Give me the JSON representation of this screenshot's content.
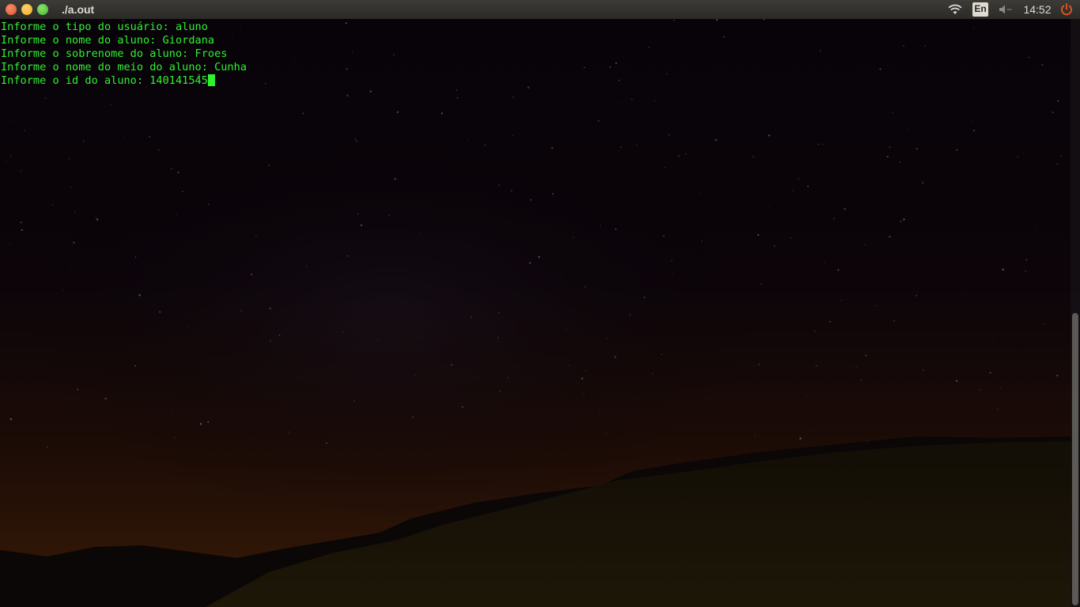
{
  "window": {
    "title": "./a.out"
  },
  "panel": {
    "language": "En",
    "clock": "14:52",
    "icons": [
      "wifi-icon",
      "keyboard-language-icon",
      "volume-muted-icon",
      "power-icon"
    ],
    "power_color": "#e95420"
  },
  "terminal": {
    "lines": [
      "Informe o tipo do usuário: aluno",
      "Informe o nome do aluno: Giordana",
      "Informe o sobrenome do aluno: Froes",
      "Informe o nome do meio do aluno: Cunha",
      "Informe o id do aluno: 140141545"
    ],
    "text_color": "#2ff22f"
  }
}
